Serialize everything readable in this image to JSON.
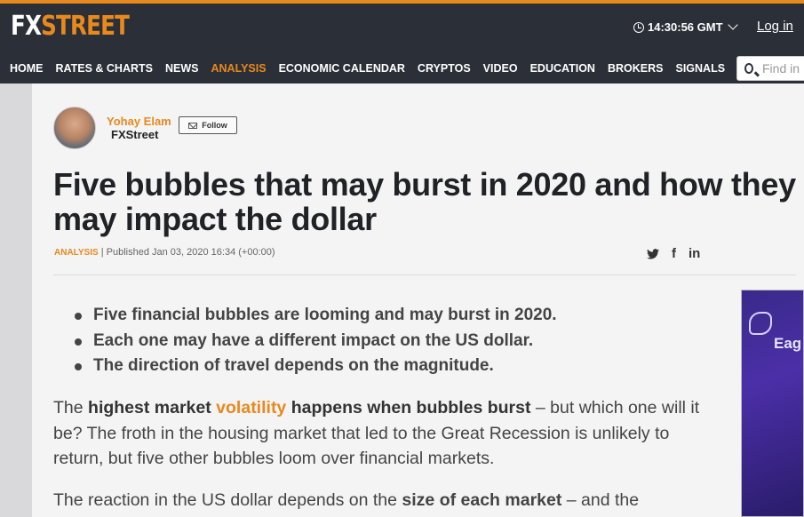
{
  "header": {
    "logo_fx": "FX",
    "logo_street": "STREET",
    "time": "14:30:56 GMT",
    "login": "Log in"
  },
  "nav": {
    "items": [
      "HOME",
      "RATES & CHARTS",
      "NEWS",
      "ANALYSIS",
      "ECONOMIC CALENDAR",
      "CRYPTOS",
      "VIDEO",
      "EDUCATION",
      "BROKERS",
      "SIGNALS"
    ],
    "active": "ANALYSIS",
    "search_placeholder": "Find in"
  },
  "byline": {
    "author": "Yohay Elam",
    "source": "FXStreet",
    "follow": "Follow"
  },
  "article": {
    "title": "Five bubbles that may burst in 2020 and how they may impact the dollar",
    "category": "ANALYSIS",
    "published": "| Published Jan 03, 2020 16:34 (+00:00)",
    "bullets": [
      "Five financial bubbles are looming and may burst in 2020.",
      "Each one may have a different impact on the US dollar.",
      "The direction of travel depends on the magnitude."
    ],
    "p1_a": "The ",
    "p1_b": "highest market ",
    "p1_link": "volatility",
    "p1_c": " happens when bubbles burst",
    "p1_d": " – but which one will it be? The froth in the housing market that led to the Great Recession is unlikely to return, but five other bubbles loom over financial markets.",
    "p2_a": "The reaction in the US dollar depends on the ",
    "p2_b": "size of each market",
    "p2_c": " – and the"
  },
  "social": {
    "facebook": "f",
    "linkedin": "in"
  },
  "ad": {
    "text": "Eag"
  },
  "colors": {
    "accent": "#e8891d",
    "header_bg": "#2b2f38"
  }
}
